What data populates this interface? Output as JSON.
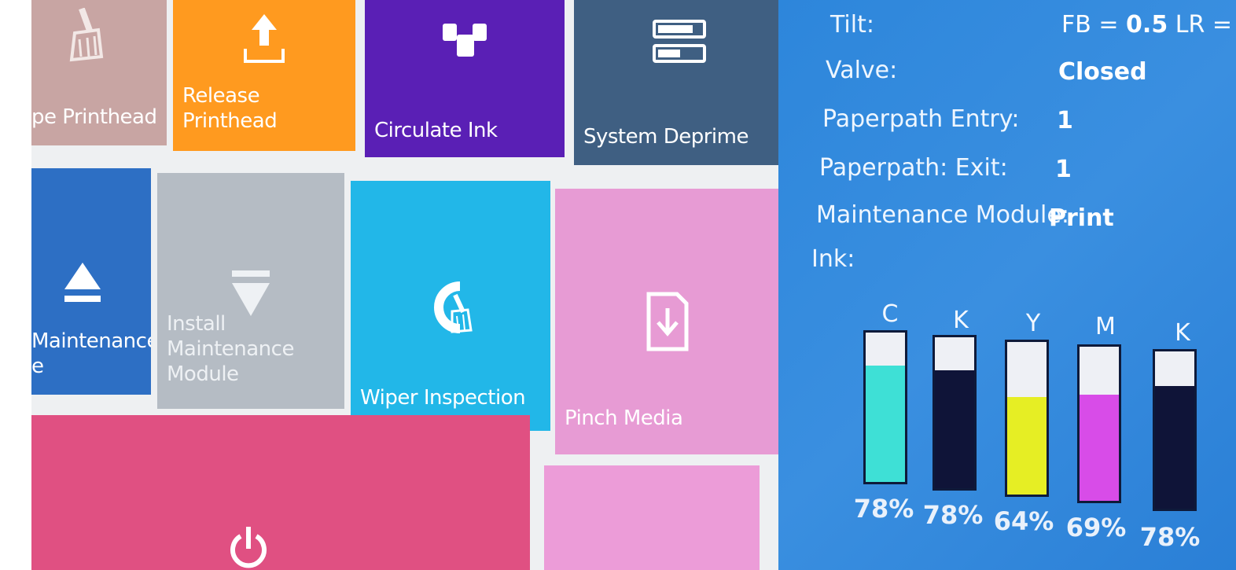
{
  "tiles": {
    "wipe_printhead": {
      "label": "pe Printhead",
      "color": "#c8a5a3",
      "icon": "broom-icon"
    },
    "release_printhead": {
      "label": "Release Printhead",
      "color": "#ff9a1f",
      "icon": "upload-icon"
    },
    "circulate_ink": {
      "label": "Circulate Ink",
      "color": "#5a1fb5",
      "icon": "circulate-icon"
    },
    "system_deprime": {
      "label": "System Deprime",
      "color": "#3f5f82",
      "icon": "deprime-icon"
    },
    "remove_maintenance": {
      "label_line1": "Maintenance",
      "label_line2": "e",
      "color": "#2d6fc4",
      "icon": "eject-icon"
    },
    "install_maintenance": {
      "label_line1": "Install Maintenance",
      "label_line2": "Module",
      "color": "#b5bcc4",
      "icon": "install-icon"
    },
    "wiper_inspection": {
      "label": "Wiper Inspection",
      "color": "#22b7e8",
      "icon": "wiper-icon"
    },
    "pinch_media": {
      "label": "Pinch Media",
      "color": "#e79bd4",
      "icon": "media-icon"
    },
    "power": {
      "color": "#e05082",
      "icon": "power-icon"
    },
    "pink_tile": {
      "color": "#ec9cd8"
    }
  },
  "status": {
    "tilt_label": "Tilt:",
    "tilt_value_prefix": "FB = ",
    "tilt_fb": "0.5",
    "tilt_value_suffix": " LR = (",
    "valve_label": "Valve:",
    "valve_value": "Closed",
    "entry_label": "Paperpath Entry:",
    "entry_value": "1",
    "exit_label": "Paperpath: Exit:",
    "exit_value": "1",
    "module_label": "Maintenance Module:",
    "module_value": "Print",
    "ink_label": "Ink:"
  },
  "ink": [
    {
      "letter": "C",
      "percent_text": "78%",
      "level": 0.78,
      "color": "#3ee0d6"
    },
    {
      "letter": "K",
      "percent_text": "78%",
      "level": 0.78,
      "color": "#0f1438"
    },
    {
      "letter": "Y",
      "percent_text": "64%",
      "level": 0.64,
      "color": "#e6ee24"
    },
    {
      "letter": "M",
      "percent_text": "69%",
      "level": 0.69,
      "color": "#d84ce8"
    },
    {
      "letter": "K",
      "percent_text": "78%",
      "level": 0.78,
      "color": "#0f1438"
    }
  ]
}
